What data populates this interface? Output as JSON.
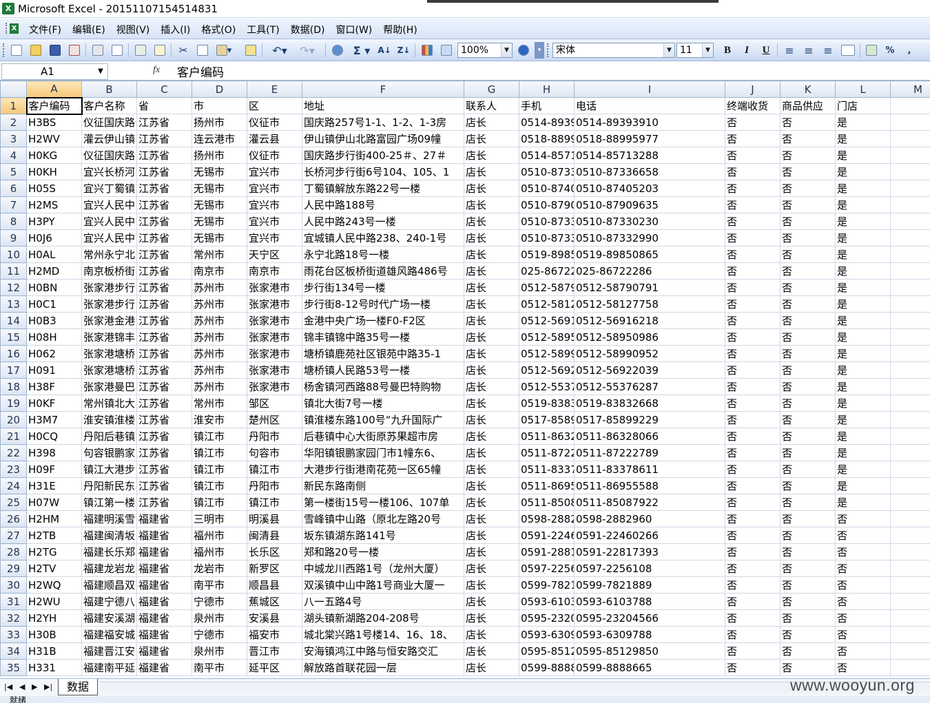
{
  "window": {
    "title": "Microsoft Excel - 20151107154514831",
    "app_icon": "excel-icon"
  },
  "menu": {
    "items": [
      "文件(F)",
      "编辑(E)",
      "视图(V)",
      "插入(I)",
      "格式(O)",
      "工具(T)",
      "数据(D)",
      "窗口(W)",
      "帮助(H)"
    ]
  },
  "toolbar": {
    "zoom": "100%",
    "font_name": "宋体",
    "font_size": "11",
    "bold": "B",
    "italic": "I",
    "underline": "U",
    "percent": "%",
    "comma": ",",
    "sum": "Σ"
  },
  "formula_bar": {
    "name_box": "A1",
    "fx": "fx",
    "value": "客户编码"
  },
  "grid": {
    "col_headers": [
      "A",
      "B",
      "C",
      "D",
      "E",
      "F",
      "G",
      "H",
      "I",
      "J",
      "K",
      "L",
      "M"
    ],
    "rows": [
      [
        "客户编码",
        "客户名称",
        "省",
        "市",
        "区",
        "地址",
        "联系人",
        "手机",
        "电话",
        "终端收货",
        "商品供应",
        "门店",
        ""
      ],
      [
        "H3BS",
        "仪征国庆路",
        "江苏省",
        "扬州市",
        "仪征市",
        "国庆路257号1-1、1-2、1-3房",
        "店长",
        "0514-8939",
        "0514-89393910",
        "否",
        "否",
        "是",
        ""
      ],
      [
        "H2WV",
        "灌云伊山镇",
        "江苏省",
        "连云港市",
        "灌云县",
        "伊山镇伊山北路富园广场09幢",
        "店长",
        "0518-8899",
        "0518-88995977",
        "否",
        "否",
        "是",
        ""
      ],
      [
        "H0KG",
        "仪征国庆路",
        "江苏省",
        "扬州市",
        "仪征市",
        "国庆路步行街400-25＃、27＃",
        "店长",
        "0514-8571",
        "0514-85713288",
        "否",
        "否",
        "是",
        ""
      ],
      [
        "H0KH",
        "宜兴长桥河",
        "江苏省",
        "无锡市",
        "宜兴市",
        "长桥河步行街6号104、105、1",
        "店长",
        "0510-8733",
        "0510-87336658",
        "否",
        "否",
        "是",
        ""
      ],
      [
        "H05S",
        "宜兴丁蜀镇",
        "江苏省",
        "无锡市",
        "宜兴市",
        "丁蜀镇解放东路22号一楼",
        "店长",
        "0510-8740",
        "0510-87405203",
        "否",
        "否",
        "是",
        ""
      ],
      [
        "H2MS",
        "宜兴人民中",
        "江苏省",
        "无锡市",
        "宜兴市",
        "人民中路188号",
        "店长",
        "0510-8790",
        "0510-87909635",
        "否",
        "否",
        "是",
        ""
      ],
      [
        "H3PY",
        "宜兴人民中",
        "江苏省",
        "无锡市",
        "宜兴市",
        "人民中路243号一楼",
        "店长",
        "0510-8733",
        "0510-87330230",
        "否",
        "否",
        "是",
        ""
      ],
      [
        "H0J6",
        "宜兴人民中",
        "江苏省",
        "无锡市",
        "宜兴市",
        "宜城镇人民中路238、240-1号",
        "店长",
        "0510-8733",
        "0510-87332990",
        "否",
        "否",
        "是",
        ""
      ],
      [
        "H0AL",
        "常州永宁北",
        "江苏省",
        "常州市",
        "天宁区",
        "永宁北路18号一楼",
        "店长",
        "0519-8985",
        "0519-89850865",
        "否",
        "否",
        "是",
        ""
      ],
      [
        "H2MD",
        "南京板桥街",
        "江苏省",
        "南京市",
        "南京市",
        "雨花台区板桥街道雄风路486号",
        "店长",
        "025-86722",
        "025-86722286",
        "否",
        "否",
        "是",
        ""
      ],
      [
        "H0BN",
        "张家港步行",
        "江苏省",
        "苏州市",
        "张家港市",
        "步行街134号一楼",
        "店长",
        "0512-5879",
        "0512-58790791",
        "否",
        "否",
        "是",
        ""
      ],
      [
        "H0C1",
        "张家港步行",
        "江苏省",
        "苏州市",
        "张家港市",
        "步行街8-12号时代广场一楼",
        "店长",
        "0512-5812",
        "0512-58127758",
        "否",
        "否",
        "是",
        ""
      ],
      [
        "H0B3",
        "张家港金港",
        "江苏省",
        "苏州市",
        "张家港市",
        "金港中央广场一楼F0-F2区",
        "店长",
        "0512-5691",
        "0512-56916218",
        "否",
        "否",
        "是",
        ""
      ],
      [
        "H08H",
        "张家港锦丰",
        "江苏省",
        "苏州市",
        "张家港市",
        "锦丰镇锦中路35号一楼",
        "店长",
        "0512-5895",
        "0512-58950986",
        "否",
        "否",
        "是",
        ""
      ],
      [
        "H062",
        "张家港塘桥",
        "江苏省",
        "苏州市",
        "张家港市",
        "塘桥镇鹿苑社区银苑中路35-1",
        "店长",
        "0512-5899",
        "0512-58990952",
        "否",
        "否",
        "是",
        ""
      ],
      [
        "H091",
        "张家港塘桥",
        "江苏省",
        "苏州市",
        "张家港市",
        "塘桥镇人民路53号一楼",
        "店长",
        "0512-5692",
        "0512-56922039",
        "否",
        "否",
        "是",
        ""
      ],
      [
        "H38F",
        "张家港曼巴",
        "江苏省",
        "苏州市",
        "张家港市",
        "杨舍镇河西路88号曼巴特购物",
        "店长",
        "0512-5537",
        "0512-55376287",
        "否",
        "否",
        "是",
        ""
      ],
      [
        "H0KF",
        "常州镇北大",
        "江苏省",
        "常州市",
        "邹区",
        "镇北大街7号一楼",
        "店长",
        "0519-8383",
        "0519-83832668",
        "否",
        "否",
        "是",
        ""
      ],
      [
        "H3M7",
        "淮安镇淮楼",
        "江苏省",
        "淮安市",
        "楚州区",
        "镇淮楼东路100号“九升国际广",
        "店长",
        "0517-8589",
        "0517-85899229",
        "否",
        "否",
        "是",
        ""
      ],
      [
        "H0CQ",
        "丹阳后巷镇",
        "江苏省",
        "镇江市",
        "丹阳市",
        "后巷镇中心大街原苏果超市房",
        "店长",
        "0511-8632",
        "0511-86328066",
        "否",
        "否",
        "是",
        ""
      ],
      [
        "H398",
        "句容银鹏家",
        "江苏省",
        "镇江市",
        "句容市",
        "华阳镇银鹏家园门市1幢东6、",
        "店长",
        "0511-8722",
        "0511-87222789",
        "否",
        "否",
        "是",
        ""
      ],
      [
        "H09F",
        "镇江大港步",
        "江苏省",
        "镇江市",
        "镇江市",
        "大港步行街港南花苑一区65幢",
        "店长",
        "0511-8337",
        "0511-83378611",
        "否",
        "否",
        "是",
        ""
      ],
      [
        "H31E",
        "丹阳新民东",
        "江苏省",
        "镇江市",
        "丹阳市",
        "新民东路南侧",
        "店长",
        "0511-8695",
        "0511-86955588",
        "否",
        "否",
        "是",
        ""
      ],
      [
        "H07W",
        "镇江第一楼",
        "江苏省",
        "镇江市",
        "镇江市",
        "第一楼街15号一楼106、107单",
        "店长",
        "0511-8508",
        "0511-85087922",
        "否",
        "否",
        "是",
        ""
      ],
      [
        "H2HM",
        "福建明溪雪",
        "福建省",
        "三明市",
        "明溪县",
        "雪峰镇中山路（原北左路20号",
        "店长",
        "0598-2882",
        "0598-2882960",
        "否",
        "否",
        "否",
        ""
      ],
      [
        "H2TB",
        "福建闽清坂",
        "福建省",
        "福州市",
        "闽清县",
        "坂东镇湖东路141号",
        "店长",
        "0591-2246",
        "0591-22460266",
        "否",
        "否",
        "否",
        ""
      ],
      [
        "H2TG",
        "福建长乐郑",
        "福建省",
        "福州市",
        "长乐区",
        "郑和路20号一楼",
        "店长",
        "0591-2881",
        "0591-22817393",
        "否",
        "否",
        "否",
        ""
      ],
      [
        "H2TV",
        "福建龙岩龙",
        "福建省",
        "龙岩市",
        "新罗区",
        "中城龙川西路1号（龙州大厦）",
        "店长",
        "0597-2256",
        "0597-2256108",
        "否",
        "否",
        "否",
        ""
      ],
      [
        "H2WQ",
        "福建顺昌双",
        "福建省",
        "南平市",
        "顺昌县",
        "双溪镇中山中路1号商业大厦一",
        "店长",
        "0599-7821",
        "0599-7821889",
        "否",
        "否",
        "否",
        ""
      ],
      [
        "H2WU",
        "福建宁德八",
        "福建省",
        "宁德市",
        "蕉城区",
        "八一五路4号",
        "店长",
        "0593-6103",
        "0593-6103788",
        "否",
        "否",
        "否",
        ""
      ],
      [
        "H2YH",
        "福建安溪湖",
        "福建省",
        "泉州市",
        "安溪县",
        "湖头镇新湖路204-208号",
        "店长",
        "0595-2320",
        "0595-23204566",
        "否",
        "否",
        "否",
        ""
      ],
      [
        "H30B",
        "福建福安城",
        "福建省",
        "宁德市",
        "福安市",
        "城北棠兴路1号楼14、16、18、",
        "店长",
        "0593-6309",
        "0593-6309788",
        "否",
        "否",
        "否",
        ""
      ],
      [
        "H31B",
        "福建晋江安",
        "福建省",
        "泉州市",
        "晋江市",
        "安海镇鸿江中路与恒安路交汇",
        "店长",
        "0595-8512",
        "0595-85129850",
        "否",
        "否",
        "否",
        ""
      ],
      [
        "H331",
        "福建南平延",
        "福建省",
        "南平市",
        "延平区",
        "解放路首联花园一层",
        "店长",
        "0599-8888",
        "0599-8888665",
        "否",
        "否",
        "否",
        ""
      ]
    ]
  },
  "sheets": {
    "active_tab": "数据"
  },
  "status": {
    "text": "就绪"
  },
  "watermark": "www.wooyun.org"
}
